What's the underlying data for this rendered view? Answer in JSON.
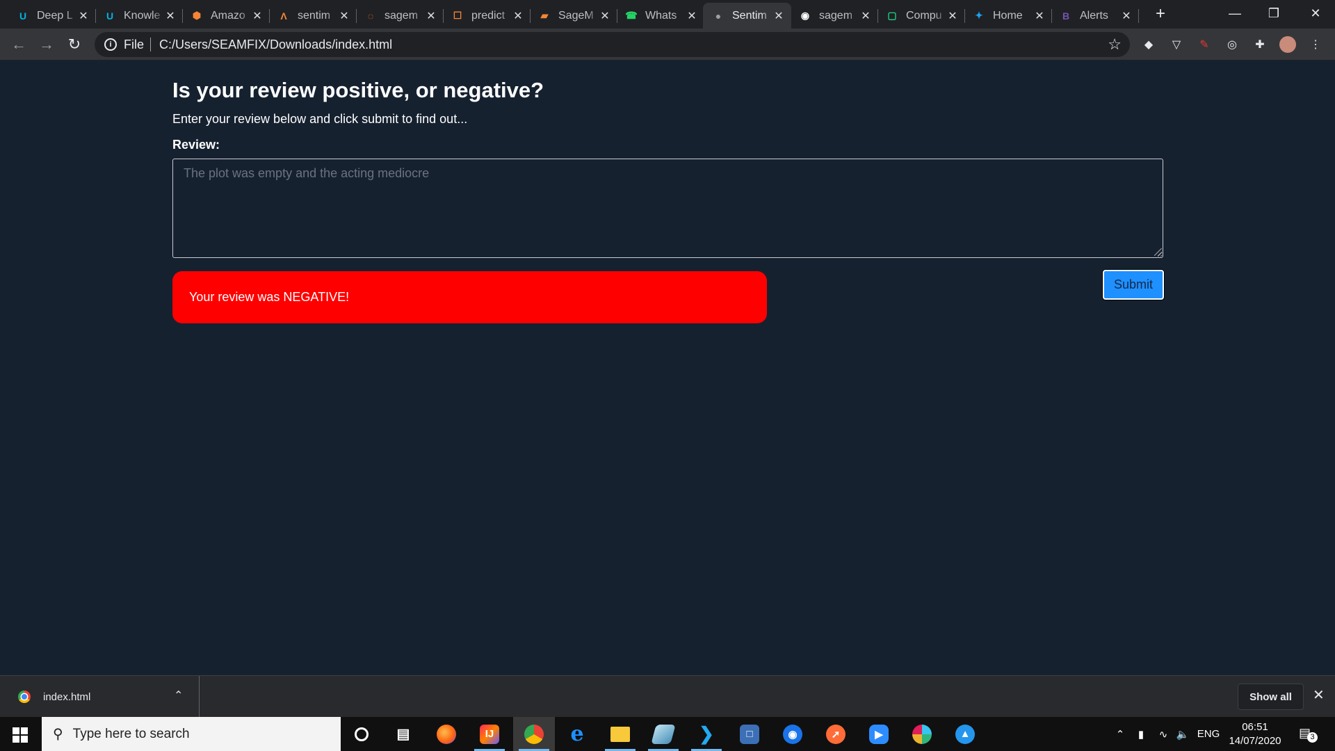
{
  "browser": {
    "tabs": [
      {
        "title": "Deep L",
        "icon": "udacity-icon",
        "color": "#02b3e4"
      },
      {
        "title": "Knowle",
        "icon": "udacity-icon",
        "color": "#02b3e4"
      },
      {
        "title": "Amazo",
        "icon": "aws-icon",
        "color": "#f58536"
      },
      {
        "title": "sentim",
        "icon": "lambda-icon",
        "color": "#f58536"
      },
      {
        "title": "sagem",
        "icon": "jupyter-icon",
        "color": "#f37626"
      },
      {
        "title": "predict",
        "icon": "document-icon",
        "color": "#f58536"
      },
      {
        "title": "SageM",
        "icon": "sagemaker-icon",
        "color": "#f58536"
      },
      {
        "title": "Whats",
        "icon": "whatsapp-icon",
        "color": "#25d366"
      },
      {
        "title": "Sentim",
        "icon": "globe-icon",
        "color": "#9aa0a6",
        "active": true
      },
      {
        "title": "sagem",
        "icon": "github-icon",
        "color": "#ffffff"
      },
      {
        "title": "Compu",
        "icon": "notion-icon",
        "color": "#1ecf85"
      },
      {
        "title": "Home",
        "icon": "twitter-icon",
        "color": "#1da1f2"
      },
      {
        "title": "Alerts",
        "icon": "bootstrap-icon",
        "color": "#7952b3"
      }
    ],
    "new_tab": "+",
    "address": {
      "scheme": "File",
      "url": "C:/Users/SEAMFIX/Downloads/index.html"
    }
  },
  "page": {
    "heading": "Is your review positive, or negative?",
    "subtext": "Enter your review below and click submit to find out...",
    "review_label": "Review:",
    "review_placeholder": "The plot was empty and the acting mediocre",
    "result_text": "Your review was NEGATIVE!",
    "result_color": "#ff0000",
    "submit_label": "Submit",
    "submit_color": "#1e90ff"
  },
  "downloads": {
    "file_name": "index.html",
    "show_all": "Show all"
  },
  "taskbar": {
    "search_placeholder": "Type here to search",
    "language": "ENG",
    "time": "06:51",
    "date": "14/07/2020",
    "notification_count": "3"
  }
}
